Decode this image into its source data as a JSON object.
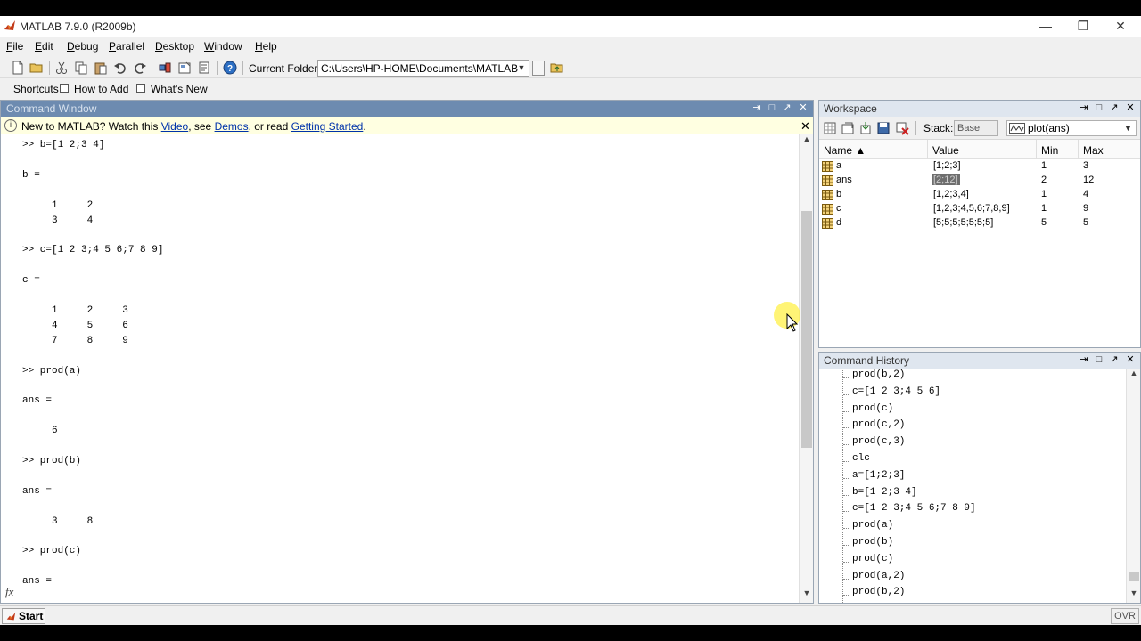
{
  "window": {
    "title": "MATLAB  7.9.0 (R2009b)",
    "minimize": "—",
    "maximize": "❐",
    "close": "✕"
  },
  "menu": [
    "File",
    "Edit",
    "Debug",
    "Parallel",
    "Desktop",
    "Window",
    "Help"
  ],
  "toolbar": {
    "current_folder_label": "Current Folder:",
    "current_folder_value": "C:\\Users\\HP-HOME\\Documents\\MATLAB",
    "browse_label": "..."
  },
  "shortcuts": {
    "label": "Shortcuts",
    "how_to_add": "How to Add",
    "whats_new": "What's New"
  },
  "command_window": {
    "title": "Command Window",
    "notice": {
      "prefix": "New to MATLAB? Watch this ",
      "video_link": "Video",
      "middle": ", see ",
      "demos_link": "Demos",
      "or_read": ", or read ",
      "getting_started_link": "Getting Started",
      "suffix": "."
    },
    "fx": "fx",
    "lines": [
      ">> b=[1 2;3 4]",
      "",
      "b =",
      "",
      "     1     2",
      "     3     4",
      "",
      ">> c=[1 2 3;4 5 6;7 8 9]",
      "",
      "c =",
      "",
      "     1     2     3",
      "     4     5     6",
      "     7     8     9",
      "",
      ">> prod(a)",
      "",
      "ans =",
      "",
      "     6",
      "",
      ">> prod(b)",
      "",
      "ans =",
      "",
      "     3     8",
      "",
      ">> prod(c)",
      "",
      "ans ="
    ]
  },
  "workspace": {
    "title": "Workspace",
    "stack_label": "Stack:",
    "stack_value": "Base",
    "plot_select": "plot(ans)",
    "columns": [
      "Name ▲",
      "Value",
      "Min",
      "Max"
    ],
    "rows": [
      {
        "name": "a",
        "value": "[1;2;3]",
        "min": "1",
        "max": "3",
        "selected": false
      },
      {
        "name": "ans",
        "value": "[2;12]",
        "min": "2",
        "max": "12",
        "selected": true
      },
      {
        "name": "b",
        "value": "[1,2;3,4]",
        "min": "1",
        "max": "4",
        "selected": false
      },
      {
        "name": "c",
        "value": "[1,2,3;4,5,6;7,8,9]",
        "min": "1",
        "max": "9",
        "selected": false
      },
      {
        "name": "d",
        "value": "[5;5;5;5;5;5;5]",
        "min": "5",
        "max": "5",
        "selected": false
      }
    ]
  },
  "history": {
    "title": "Command History",
    "items": [
      "prod(b,2)",
      "c=[1 2 3;4 5 6]",
      "prod(c)",
      "prod(c,2)",
      "prod(c,3)",
      "clc",
      "a=[1;2;3]",
      "b=[1 2;3 4]",
      "c=[1 2 3;4 5 6;7 8 9]",
      "prod(a)",
      "prod(b)",
      "prod(c)",
      "prod(a,2)",
      "prod(b,2)"
    ]
  },
  "statusbar": {
    "start": "Start",
    "ovr": "OVR"
  },
  "colors": {
    "command_titlebar": "#6d8bb0",
    "notice_background": "#ffffe1",
    "link": "#0033aa",
    "selection": "#6e6e6e"
  }
}
